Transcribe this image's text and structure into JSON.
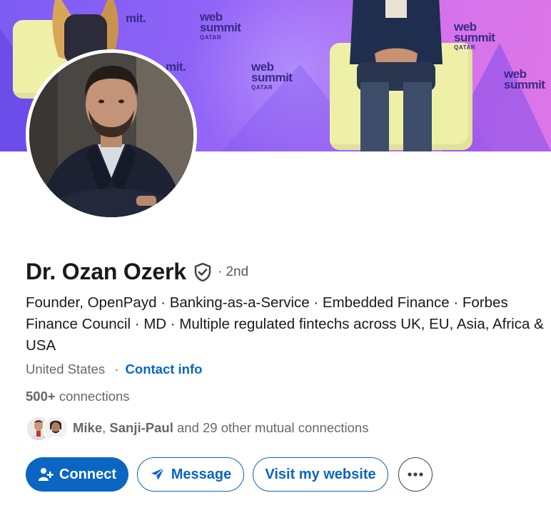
{
  "profile": {
    "name": "Dr. Ozan Ozerk",
    "verified_icon": "shield-check-icon",
    "degree": "· 2nd",
    "headline": "Founder, OpenPayd · Banking-as-a-Service · Embedded Finance · Forbes Finance Council · MD · Multiple regulated fintechs across UK, EU,  Asia, Africa & USA",
    "location": "United States",
    "location_separator": "·",
    "contact_info_label": "Contact info",
    "connections_count": "500+",
    "connections_label": "connections"
  },
  "mutual": {
    "name1": "Mike",
    "comma": ",",
    "name2": "Sanji-Paul",
    "rest": "and 29 other mutual connections"
  },
  "banner": {
    "logos": [
      {
        "brand": "web summit",
        "sub": "QATAR"
      }
    ],
    "logo_text": "web",
    "logo_text2": "summit",
    "logo_sub": "QATAR"
  },
  "actions": {
    "connect_label": "Connect",
    "connect_icon": "add-person-icon",
    "message_label": "Message",
    "message_icon": "send-icon",
    "website_label": "Visit my website",
    "more_icon": "more-horizontal-icon"
  },
  "colors": {
    "brand_blue": "#0a66c2",
    "banner_purple": "#8f63f7",
    "banner_pink": "#d66fe6"
  }
}
